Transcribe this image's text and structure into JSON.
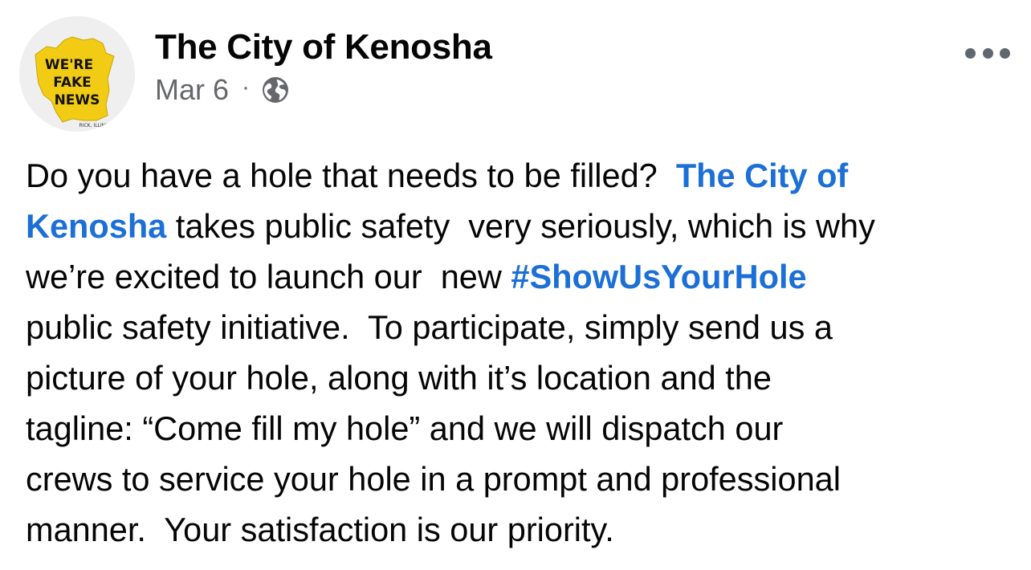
{
  "post": {
    "author": "The City of Kenosha",
    "date": "Mar 6",
    "separator": "·",
    "privacy_icon": "globe-icon",
    "more_icon": "more-dots-icon",
    "avatar": {
      "icon": "wisconsin-map-logo",
      "text_lines": [
        "WE'RE",
        "FAKE",
        "NEWS"
      ],
      "small_text": "RICK, ILLINOIS",
      "colors": {
        "map": "#f2cc14",
        "text": "#111111",
        "background": "#efefef"
      }
    },
    "body": {
      "line1_text": "Do you have a hole that needs to be filled?  ",
      "line1_link": "The City of",
      "line2_link": "Kenosha",
      "line2_text": " takes public safety  very seriously, which is why",
      "line3_text": "we’re excited to launch our  new ",
      "line3_hashtag": "#ShowUsYourHole",
      "line4_text": "public safety initiative.  To participate, simply send us a",
      "line5_text": "picture of your hole, along with it’s location and the",
      "line6_text": "tagline: “Come fill my hole” and we will dispatch our",
      "line7_text": "crews to service your hole in a prompt and professional",
      "line8_text": "manner.  Your satisfaction is our priority."
    }
  },
  "colors": {
    "link": "#1b6fd6",
    "text": "#050505",
    "meta": "#65676b",
    "background": "#ffffff"
  }
}
